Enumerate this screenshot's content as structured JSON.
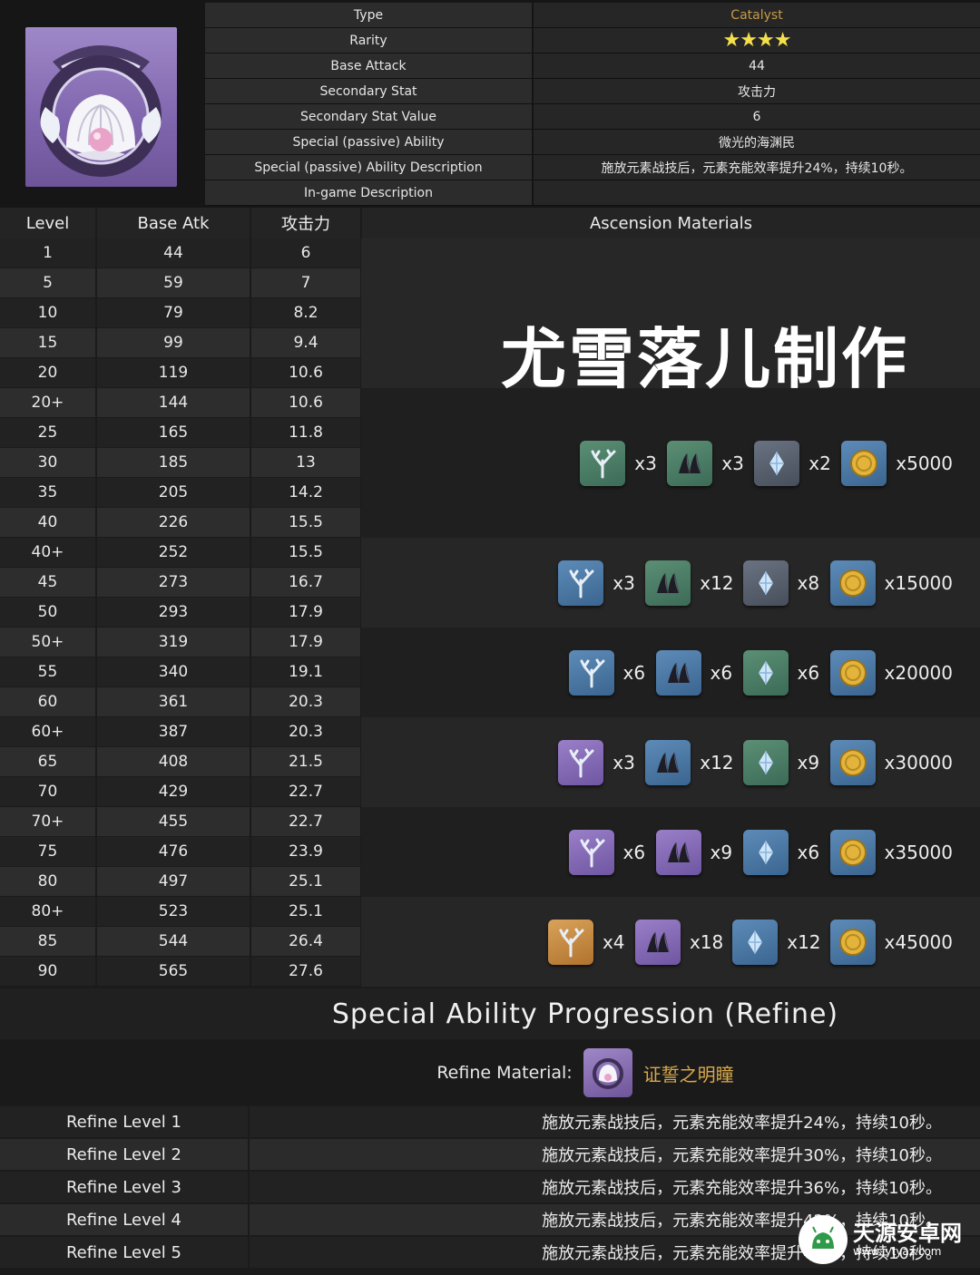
{
  "info": {
    "rows": [
      {
        "label": "Type",
        "value": "Catalyst"
      },
      {
        "label": "Rarity",
        "value": "★★★★"
      },
      {
        "label": "Base Attack",
        "value": "44"
      },
      {
        "label": "Secondary Stat",
        "value": "攻击力"
      },
      {
        "label": "Secondary Stat Value",
        "value": "6"
      },
      {
        "label": "Special (passive) Ability",
        "value": "微光的海渊民"
      },
      {
        "label": "Special (passive) Ability Description",
        "value": "施放元素战技后，元素充能效率提升24%，持续10秒。"
      },
      {
        "label": "In-game Description",
        "value": ""
      }
    ],
    "rarity_stars": 4
  },
  "stats": {
    "headers": {
      "level": "Level",
      "base_atk": "Base Atk",
      "secondary": "攻击力",
      "materials": "Ascension Materials"
    },
    "rows": [
      {
        "level": "1",
        "base_atk": "44",
        "secondary": "6"
      },
      {
        "level": "5",
        "base_atk": "59",
        "secondary": "7"
      },
      {
        "level": "10",
        "base_atk": "79",
        "secondary": "8.2"
      },
      {
        "level": "15",
        "base_atk": "99",
        "secondary": "9.4"
      },
      {
        "level": "20",
        "base_atk": "119",
        "secondary": "10.6"
      },
      {
        "level": "20+",
        "base_atk": "144",
        "secondary": "10.6"
      },
      {
        "level": "25",
        "base_atk": "165",
        "secondary": "11.8"
      },
      {
        "level": "30",
        "base_atk": "185",
        "secondary": "13"
      },
      {
        "level": "35",
        "base_atk": "205",
        "secondary": "14.2"
      },
      {
        "level": "40",
        "base_atk": "226",
        "secondary": "15.5"
      },
      {
        "level": "40+",
        "base_atk": "252",
        "secondary": "15.5"
      },
      {
        "level": "45",
        "base_atk": "273",
        "secondary": "16.7"
      },
      {
        "level": "50",
        "base_atk": "293",
        "secondary": "17.9"
      },
      {
        "level": "50+",
        "base_atk": "319",
        "secondary": "17.9"
      },
      {
        "level": "55",
        "base_atk": "340",
        "secondary": "19.1"
      },
      {
        "level": "60",
        "base_atk": "361",
        "secondary": "20.3"
      },
      {
        "level": "60+",
        "base_atk": "387",
        "secondary": "20.3"
      },
      {
        "level": "65",
        "base_atk": "408",
        "secondary": "21.5"
      },
      {
        "level": "70",
        "base_atk": "429",
        "secondary": "22.7"
      },
      {
        "level": "70+",
        "base_atk": "455",
        "secondary": "22.7"
      },
      {
        "level": "75",
        "base_atk": "476",
        "secondary": "23.9"
      },
      {
        "level": "80",
        "base_atk": "497",
        "secondary": "25.1"
      },
      {
        "level": "80+",
        "base_atk": "523",
        "secondary": "25.1"
      },
      {
        "level": "85",
        "base_atk": "544",
        "secondary": "26.4"
      },
      {
        "level": "90",
        "base_atk": "565",
        "secondary": "27.6"
      }
    ],
    "watermark": "尤雪落儿制作",
    "material_groups": [
      {
        "items": [
          {
            "icon": "coral-branch-icon",
            "tier": "green",
            "qty": "x3"
          },
          {
            "icon": "claw-fragment-icon",
            "tier": "green",
            "qty": "x3"
          },
          {
            "icon": "crystal-shard-icon",
            "tier": "gray",
            "qty": "x2"
          },
          {
            "icon": "mora-coin-icon",
            "tier": "blue",
            "qty": "x5000"
          }
        ]
      },
      {
        "items": [
          {
            "icon": "coral-branch-icon",
            "tier": "blue",
            "qty": "x3"
          },
          {
            "icon": "claw-fragment-icon",
            "tier": "green",
            "qty": "x12"
          },
          {
            "icon": "crystal-shard-icon",
            "tier": "gray",
            "qty": "x8"
          },
          {
            "icon": "mora-coin-icon",
            "tier": "blue",
            "qty": "x15000"
          }
        ]
      },
      {
        "items": [
          {
            "icon": "coral-branch-icon",
            "tier": "blue",
            "qty": "x6"
          },
          {
            "icon": "claw-fragment-icon",
            "tier": "blue",
            "qty": "x6"
          },
          {
            "icon": "crystal-shard-icon",
            "tier": "green",
            "qty": "x6"
          },
          {
            "icon": "mora-coin-icon",
            "tier": "blue",
            "qty": "x20000"
          }
        ]
      },
      {
        "items": [
          {
            "icon": "coral-branch-icon",
            "tier": "purple",
            "qty": "x3"
          },
          {
            "icon": "claw-fragment-icon",
            "tier": "blue",
            "qty": "x12"
          },
          {
            "icon": "crystal-shard-icon",
            "tier": "green",
            "qty": "x9"
          },
          {
            "icon": "mora-coin-icon",
            "tier": "blue",
            "qty": "x30000"
          }
        ]
      },
      {
        "items": [
          {
            "icon": "coral-branch-icon",
            "tier": "purple",
            "qty": "x6"
          },
          {
            "icon": "claw-fragment-icon",
            "tier": "purple",
            "qty": "x9"
          },
          {
            "icon": "crystal-shard-icon",
            "tier": "blue",
            "qty": "x6"
          },
          {
            "icon": "mora-coin-icon",
            "tier": "blue",
            "qty": "x35000"
          }
        ]
      },
      {
        "items": [
          {
            "icon": "coral-branch-icon",
            "tier": "gold",
            "qty": "x4"
          },
          {
            "icon": "claw-fragment-icon",
            "tier": "purple",
            "qty": "x18"
          },
          {
            "icon": "crystal-shard-icon",
            "tier": "blue",
            "qty": "x12"
          },
          {
            "icon": "mora-coin-icon",
            "tier": "blue",
            "qty": "x45000"
          }
        ]
      }
    ]
  },
  "refine": {
    "title": "Special Ability Progression (Refine)",
    "material_label": "Refine Material:",
    "material_name": "证誓之明瞳",
    "levels": [
      {
        "label": "Refine Level 1",
        "text": "施放元素战技后，元素充能效率提升24%，持续10秒。"
      },
      {
        "label": "Refine Level 2",
        "text": "施放元素战技后，元素充能效率提升30%，持续10秒。"
      },
      {
        "label": "Refine Level 3",
        "text": "施放元素战技后，元素充能效率提升36%，持续10秒。"
      },
      {
        "label": "Refine Level 4",
        "text": "施放元素战技后，元素充能效率提升42%，持续10秒。"
      },
      {
        "label": "Refine Level 5",
        "text": "施放元素战技后，元素充能效率提升48%，持续10秒。"
      }
    ]
  },
  "logo": {
    "name": "天源安卓网",
    "url": "www.jytyaz.com"
  },
  "colors": {
    "background": "#1b1b1b",
    "catalyst": "#c89a45",
    "star": "#f3e04a",
    "material_name": "#d9a84a"
  }
}
